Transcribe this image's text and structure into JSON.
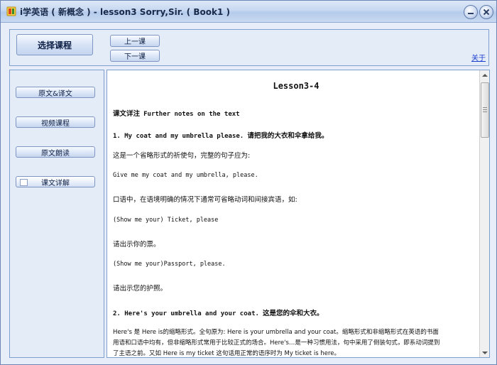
{
  "window": {
    "title": "i学英语 ( 新概念 ) -  lesson3  Sorry,Sir. ( Book1 )"
  },
  "toolbar": {
    "select_course": "选择课程",
    "prev_lesson": "上一课",
    "next_lesson": "下一课",
    "about": "关于"
  },
  "sidebar": {
    "items": [
      {
        "label": "原文&译文"
      },
      {
        "label": "视频课程"
      },
      {
        "label": "原文朗读"
      },
      {
        "label": "课文详解"
      }
    ],
    "selected_index": 3
  },
  "content": {
    "lesson_title": "Lesson3-4",
    "heading_cn": "课文详注",
    "heading_en": "Further notes on the text",
    "item1_en": "1. My coat and my umbrella please.",
    "item1_cn": "请把我的大衣和伞拿给我。",
    "item1_p1": "这是一个省略形式的祈使句，完整的句子应为:",
    "item1_ex1": "Give me my coat and my umbrella, please.",
    "item1_p2": "口语中，在语境明确的情况下通常可省略动词和间接宾语，如:",
    "item1_ex2": "(Show me your) Ticket, please",
    "item1_tr2": "请出示你的票。",
    "item1_ex3": "(Show me your)Passport, please.",
    "item1_tr3": "请出示您的护照。",
    "item2_en": "2. Here's your umbrella and your coat.",
    "item2_cn": "这是您的伞和大衣。",
    "item2_p1": "Here's 是 Here is的缩略形式。全句原为: Here is your umbrella and your coat。缩略形式和非缩略形式在英语的书面",
    "item2_p2": "用语和口语中均有，但非缩略形式常用于比较正式的场合。Here's…是一种习惯用法，句中采用了倒装句式，即系动词提到",
    "item2_p3": "了主语之前。又如 Here is my ticket 这句话用正常的语序时为 My ticket is here。"
  },
  "colors": {
    "titlebar": "#c6d8f1",
    "frame_border": "#7f9fcf",
    "panel_bg": "#e4ecf8",
    "link": "#1a3ccf"
  }
}
